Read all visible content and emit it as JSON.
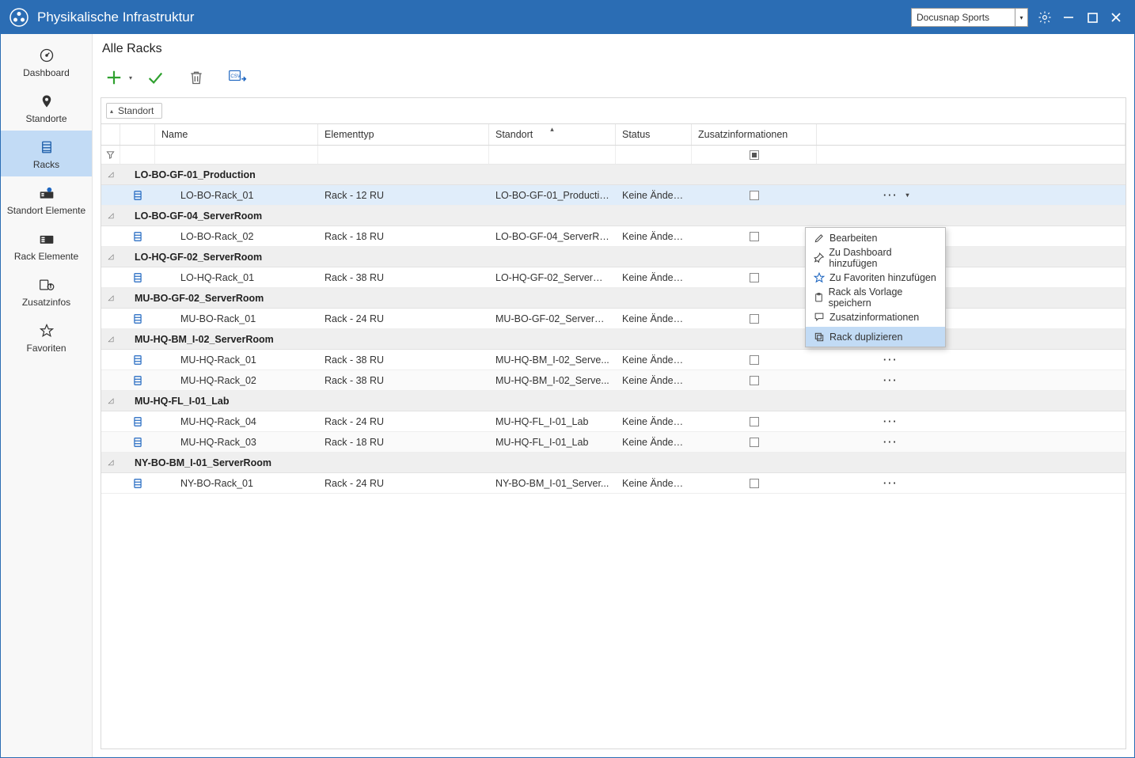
{
  "app": {
    "title": "Physikalische Infrastruktur",
    "tenant": "Docusnap Sports"
  },
  "sidebar": {
    "items": [
      {
        "label": "Dashboard"
      },
      {
        "label": "Standorte"
      },
      {
        "label": "Racks"
      },
      {
        "label": "Standort Elemente"
      },
      {
        "label": "Rack Elemente"
      },
      {
        "label": "Zusatzinfos"
      },
      {
        "label": "Favoriten"
      }
    ],
    "active": 2
  },
  "page": {
    "title": "Alle Racks",
    "group_by": "Standort"
  },
  "columns": {
    "name": "Name",
    "type": "Elementtyp",
    "site": "Standort",
    "status": "Status",
    "extra": "Zusatzinformationen"
  },
  "groups": [
    {
      "site": "LO-BO-GF-01_Production",
      "rows": [
        {
          "name": "LO-BO-Rack_01",
          "type": "Rack - 12 RU",
          "site": "LO-BO-GF-01_Production",
          "status": "Keine Änderu...",
          "selected": true
        }
      ]
    },
    {
      "site": "LO-BO-GF-04_ServerRoom",
      "rows": [
        {
          "name": "LO-BO-Rack_02",
          "type": "Rack - 18 RU",
          "site": "LO-BO-GF-04_ServerRo...",
          "status": "Keine Änderu..."
        }
      ]
    },
    {
      "site": "LO-HQ-GF-02_ServerRoom",
      "rows": [
        {
          "name": "LO-HQ-Rack_01",
          "type": "Rack - 38 RU",
          "site": "LO-HQ-GF-02_ServerRo...",
          "status": "Keine Änderu..."
        }
      ]
    },
    {
      "site": "MU-BO-GF-02_ServerRoom",
      "rows": [
        {
          "name": "MU-BO-Rack_01",
          "type": "Rack - 24 RU",
          "site": "MU-BO-GF-02_ServerR...",
          "status": "Keine Änderu..."
        }
      ]
    },
    {
      "site": "MU-HQ-BM_I-02_ServerRoom",
      "rows": [
        {
          "name": "MU-HQ-Rack_01",
          "type": "Rack - 38 RU",
          "site": "MU-HQ-BM_I-02_Serve...",
          "status": "Keine Änderu..."
        },
        {
          "name": "MU-HQ-Rack_02",
          "type": "Rack - 38 RU",
          "site": "MU-HQ-BM_I-02_Serve...",
          "status": "Keine Änderu..."
        }
      ]
    },
    {
      "site": "MU-HQ-FL_I-01_Lab",
      "rows": [
        {
          "name": "MU-HQ-Rack_04",
          "type": "Rack - 24 RU",
          "site": "MU-HQ-FL_I-01_Lab",
          "status": "Keine Änderu..."
        },
        {
          "name": "MU-HQ-Rack_03",
          "type": "Rack - 18 RU",
          "site": "MU-HQ-FL_I-01_Lab",
          "status": "Keine Änderu..."
        }
      ]
    },
    {
      "site": "NY-BO-BM_I-01_ServerRoom",
      "rows": [
        {
          "name": "NY-BO-Rack_01",
          "type": "Rack - 24 RU",
          "site": "NY-BO-BM_I-01_Server...",
          "status": "Keine Änderu..."
        }
      ]
    }
  ],
  "context_menu": {
    "items": [
      {
        "label": "Bearbeiten"
      },
      {
        "label": "Zu Dashboard hinzufügen"
      },
      {
        "label": "Zu Favoriten hinzufügen"
      },
      {
        "label": "Rack als Vorlage speichern"
      },
      {
        "label": "Zusatzinformationen"
      },
      {
        "label": "Rack duplizieren"
      }
    ],
    "selected": 5
  }
}
